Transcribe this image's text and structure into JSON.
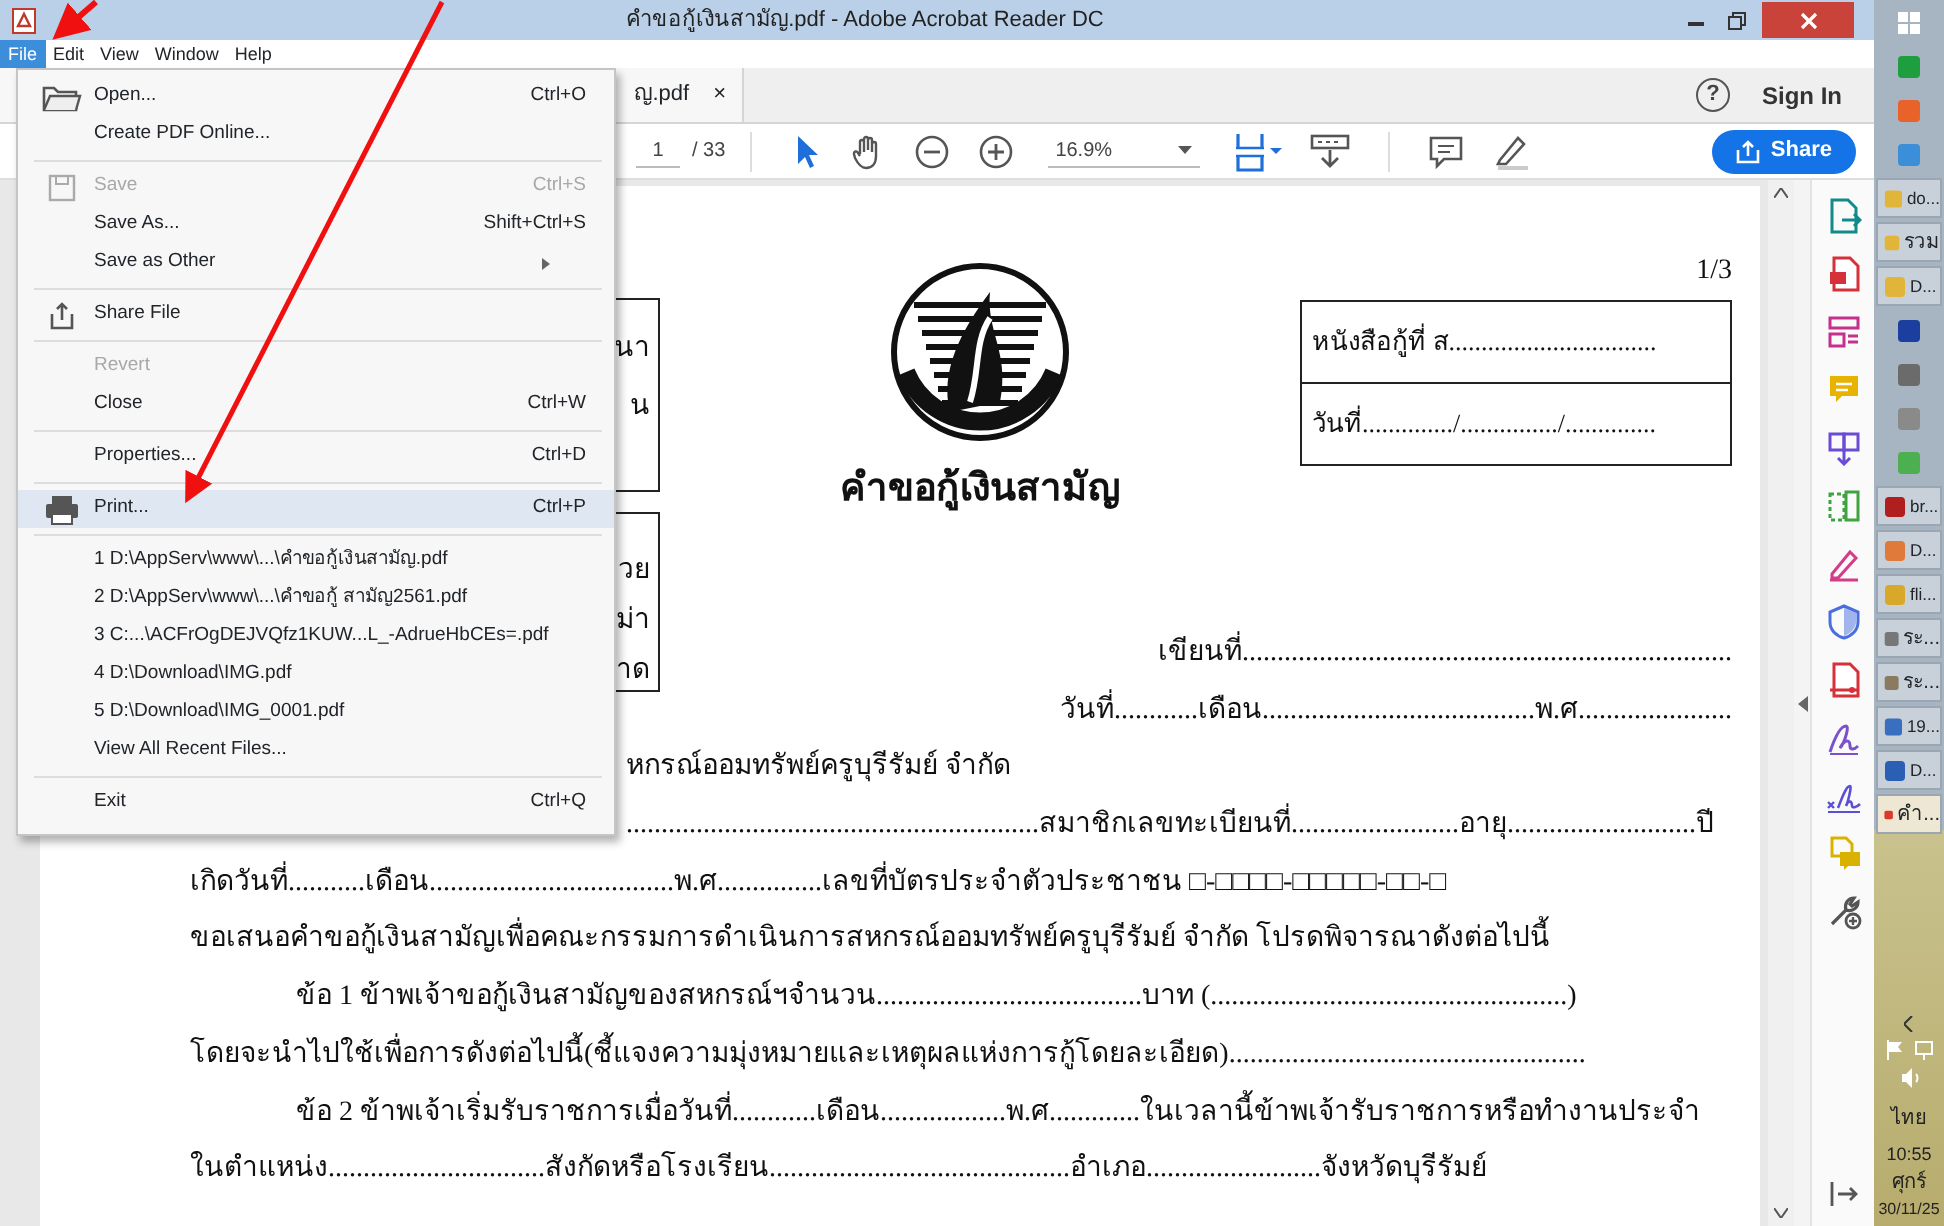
{
  "window": {
    "title": "คำขอกู้เงินสามัญ.pdf - Adobe Acrobat Reader DC"
  },
  "menubar": [
    {
      "label": "File",
      "selected": true
    },
    {
      "label": "Edit",
      "selected": false
    },
    {
      "label": "View",
      "selected": false
    },
    {
      "label": "Window",
      "selected": false
    },
    {
      "label": "Help",
      "selected": false
    }
  ],
  "tab": {
    "label": "ญ.pdf",
    "close": "×"
  },
  "account": {
    "help": "?",
    "sign_in": "Sign In"
  },
  "toolbar": {
    "page": "1",
    "page_count": "/ 33",
    "zoom": "16.9%",
    "share": "Share"
  },
  "file_menu": [
    {
      "kind": "item",
      "label": "Open...",
      "shortcut": "Ctrl+O",
      "disabled": false,
      "highlighted": false
    },
    {
      "kind": "item",
      "label": "Create PDF Online...",
      "disabled": false,
      "highlighted": false
    },
    {
      "kind": "separator"
    },
    {
      "kind": "item",
      "label": "Save",
      "shortcut": "Ctrl+S",
      "disabled": true,
      "highlighted": false
    },
    {
      "kind": "item",
      "label": "Save As...",
      "shortcut": "Shift+Ctrl+S",
      "disabled": false,
      "highlighted": false
    },
    {
      "kind": "item",
      "label": "Save as Other",
      "submenu": true,
      "disabled": false,
      "highlighted": false
    },
    {
      "kind": "separator"
    },
    {
      "kind": "item",
      "label": "Share File",
      "disabled": false,
      "highlighted": false
    },
    {
      "kind": "separator"
    },
    {
      "kind": "item",
      "label": "Revert",
      "disabled": true,
      "highlighted": false
    },
    {
      "kind": "item",
      "label": "Close",
      "shortcut": "Ctrl+W",
      "disabled": false,
      "highlighted": false
    },
    {
      "kind": "separator"
    },
    {
      "kind": "item",
      "label": "Properties...",
      "shortcut": "Ctrl+D",
      "disabled": false,
      "highlighted": false
    },
    {
      "kind": "separator"
    },
    {
      "kind": "item",
      "label": "Print...",
      "shortcut": "Ctrl+P",
      "disabled": false,
      "highlighted": true
    },
    {
      "kind": "separator"
    },
    {
      "kind": "recent",
      "label": "1 D:\\AppServ\\www\\...\\คำขอกู้เงินสามัญ.pdf",
      "disabled": false,
      "highlighted": false
    },
    {
      "kind": "recent",
      "label": "2 D:\\AppServ\\www\\...\\คำขอกู้ สามัญ2561.pdf",
      "disabled": false,
      "highlighted": false
    },
    {
      "kind": "recent",
      "label": "3 C:...\\ACFrOgDEJVQfz1KUW...L_-AdrueHbCEs=.pdf",
      "disabled": false,
      "highlighted": false
    },
    {
      "kind": "recent",
      "label": "4 D:\\Download\\IMG.pdf",
      "disabled": false,
      "highlighted": false
    },
    {
      "kind": "recent",
      "label": "5 D:\\Download\\IMG_0001.pdf",
      "disabled": false,
      "highlighted": false
    },
    {
      "kind": "item",
      "label": "View All Recent Files...",
      "disabled": false,
      "highlighted": false
    },
    {
      "kind": "separator"
    },
    {
      "kind": "item",
      "label": "Exit",
      "shortcut": "Ctrl+Q",
      "disabled": false,
      "highlighted": false
    }
  ],
  "document": {
    "page_number": "1/3",
    "left_box_top": [
      "นา",
      "น"
    ],
    "left_box_bottom": [
      "วย",
      "ม่า",
      "าด"
    ],
    "right_box": [
      "หนังสือกู้ที่ ส................................",
      "วันที่............../.............../.............."
    ],
    "title": "คำขอกู้เงินสามัญ",
    "lines": [
      {
        "kind": "right",
        "text": "เขียนที่......................................................................"
      },
      {
        "kind": "right",
        "text": "วันที่............เดือน.......................................พ.ศ......................"
      },
      {
        "kind": "partial",
        "text": "หกรณ์ออมทรัพย์ครูบุรีรัมย์  จำกัด"
      },
      {
        "kind": "partial",
        "text": "...........................................................สมาชิกเลขทะเบียนที่........................อายุ...........................ปี"
      },
      {
        "kind": "plain",
        "text": "เกิดวันที่...........เดือน...................................พ.ศ...............เลขที่บัตรประจำตัวประชาชน □-□□□□-□□□□□-□□-□"
      },
      {
        "kind": "plain",
        "text": "ขอเสนอคำขอกู้เงินสามัญเพื่อคณะกรรมการดำเนินการสหกรณ์ออมทรัพย์ครูบุรีรัมย์  จำกัด  โปรดพิจารณาดังต่อไปนี้"
      },
      {
        "kind": "indent",
        "text": "ข้อ 1  ข้าพเจ้าขอกู้เงินสามัญของสหกรณ์ฯจำนวน......................................บาท (...................................................)"
      },
      {
        "kind": "plain",
        "text": "โดยจะนำไปใช้เพื่อการดังต่อไปนี้(ชี้แจงความมุ่งหมายและเหตุผลแห่งการกู้โดยละเอียด)..................................................."
      },
      {
        "kind": "indent",
        "text": "ข้อ 2  ข้าพเจ้าเริ่มรับราชการเมื่อวันที่............เดือน..................พ.ศ.............ในเวลานี้ข้าพเจ้ารับราชการหรือทำงานประจำ"
      },
      {
        "kind": "plain",
        "text": "ในตำแหน่ง...............................สังกัดหรือโรงเรียน...........................................อำเภอ.........................จังหวัดบุรีรัมย์"
      }
    ]
  },
  "taskbar": {
    "items": [
      {
        "kind": "icon"
      },
      {
        "kind": "icon"
      },
      {
        "kind": "icon"
      },
      {
        "kind": "icon"
      },
      {
        "kind": "window",
        "label": "do...",
        "selected": false
      },
      {
        "kind": "window",
        "label": "รวม",
        "selected": false
      },
      {
        "kind": "window",
        "label": "D...",
        "selected": false
      },
      {
        "kind": "icon"
      },
      {
        "kind": "icon"
      },
      {
        "kind": "icon"
      },
      {
        "kind": "icon"
      },
      {
        "kind": "window",
        "label": "br...",
        "selected": false
      },
      {
        "kind": "window",
        "label": "D...",
        "selected": false
      },
      {
        "kind": "window",
        "label": "fli...",
        "selected": false
      },
      {
        "kind": "window",
        "label": "ระ...",
        "selected": false
      },
      {
        "kind": "window",
        "label": "ระ...",
        "selected": false
      },
      {
        "kind": "window",
        "label": "19...",
        "selected": false
      },
      {
        "kind": "window",
        "label": "D...",
        "selected": false
      },
      {
        "kind": "window",
        "label": "คำ...",
        "selected": true
      }
    ],
    "language": "ไทย",
    "time": "10:55",
    "day": "ศุกร์",
    "date": "30/11/25"
  }
}
